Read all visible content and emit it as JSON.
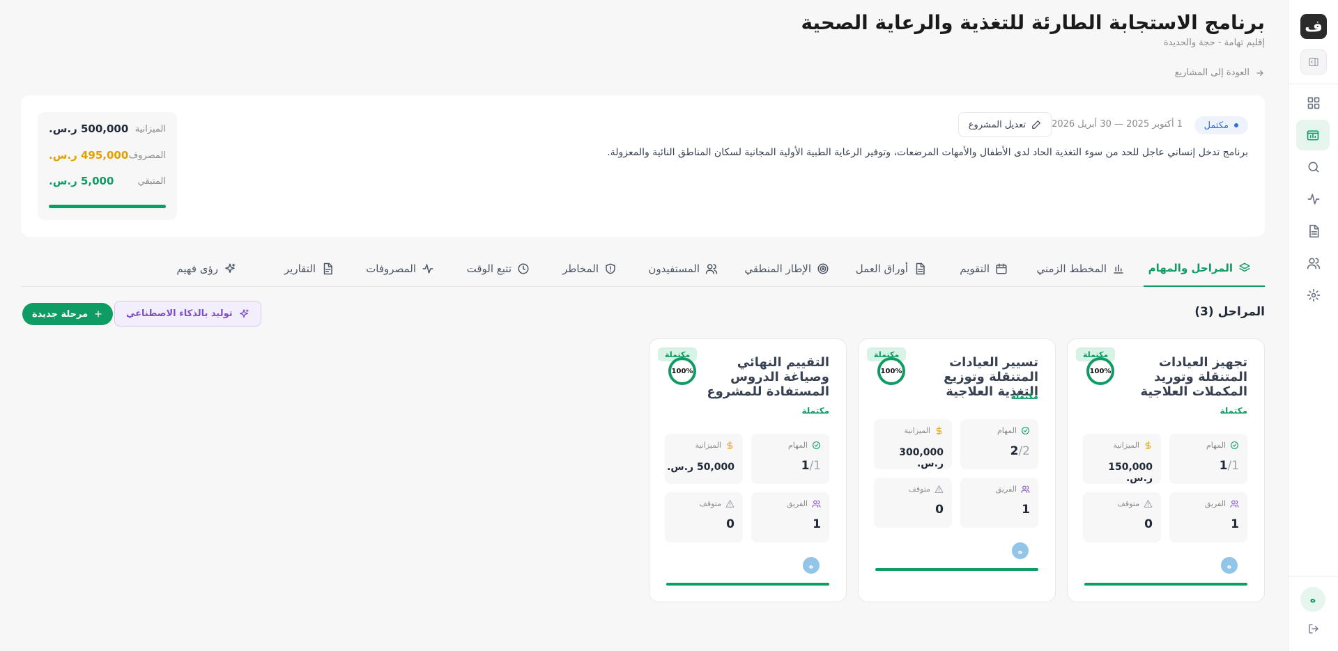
{
  "project": {
    "title": "برنامج الاستجابة الطارئة للتغذية والرعاية الصحية",
    "location": "إقليم تهامة - حجة والحديدة",
    "back_label": "العودة إلى المشاريع",
    "status": "مكتمل",
    "dates": "1 أكتوبر 2025 — 30 أبريل 2026",
    "edit_label": "تعديل المشروع",
    "description": "برنامج تدخل إنساني عاجل للحد من سوء التغذية الحاد لدى الأطفال والأمهات المرضعات، وتوفير الرعاية الطبية الأولية المجانية لسكان المناطق النائية والمعزولة.",
    "budget": {
      "budget_label": "الميزانية",
      "budget_value": "500,000 ر.س.",
      "spent_label": "المصروف",
      "spent_value": "495,000 ر.س.",
      "remaining_label": "المتبقي",
      "remaining_value": "5,000 ر.س.",
      "spent_fraction": 0.99
    }
  },
  "tabs": [
    {
      "label": "المراحل والمهام",
      "icon": "layers-icon",
      "active": true
    },
    {
      "label": "المخطط الزمني",
      "icon": "bar-chart-icon"
    },
    {
      "label": "التقويم",
      "icon": "calendar-icon"
    },
    {
      "label": "أوراق العمل",
      "icon": "file-icon"
    },
    {
      "label": "الإطار المنطقي",
      "icon": "target-icon"
    },
    {
      "label": "المستفيدون",
      "icon": "users-icon"
    },
    {
      "label": "المخاطر",
      "icon": "shield-icon"
    },
    {
      "label": "تتبع الوقت",
      "icon": "clock-icon"
    },
    {
      "label": "المصروفات",
      "icon": "activity-icon"
    },
    {
      "label": "التقارير",
      "icon": "report-icon"
    },
    {
      "label": "رؤى فهيم",
      "icon": "sparkles-icon"
    }
  ],
  "phases": {
    "heading": "المراحل (3)",
    "ai_label": "توليد بالذكاء الاصطناعي",
    "new_label": "مرحلة جديدة",
    "labels": {
      "tasks": "المهام",
      "budget": "الميزانية",
      "team": "الفريق",
      "stopped": "متوقف"
    },
    "items": [
      {
        "title": "تجهيز العيادات المتنقلة وتوريد المكملات العلاجية",
        "badge": "مكتملة",
        "percent": "100%",
        "progress": 1.0,
        "status": "مكتملة",
        "tasks_done": "1",
        "tasks_total": "/1",
        "budget": "150,000 ر.س.",
        "team": "1",
        "stopped": "0",
        "avatar": "ه"
      },
      {
        "title": "تسيير العيادات المتنقلة وتوزيع التغذية العلاجية",
        "badge": "مكتملة",
        "percent": "100%",
        "progress": 1.0,
        "status": "مكتملة",
        "tasks_done": "2",
        "tasks_total": "/2",
        "budget": "300,000 ر.س.",
        "team": "1",
        "stopped": "0",
        "avatar": "ه"
      },
      {
        "title": "التقييم النهائي وصياغة الدروس المستفادة للمشروع",
        "badge": "مكتملة",
        "percent": "100%",
        "progress": 1.0,
        "status": "مكتملة",
        "tasks_done": "1",
        "tasks_total": "/1",
        "budget": "50,000 ر.س.",
        "team": "1",
        "stopped": "0",
        "avatar": "ه"
      }
    ]
  },
  "rail": {
    "logo": "ف",
    "user_initial": "ه",
    "items": [
      "panel-toggle-icon",
      "dashboard-icon",
      "projects-icon",
      "search-icon",
      "activity-icon",
      "document-icon",
      "users-icon",
      "settings-icon",
      "logout-icon"
    ]
  },
  "colors": {
    "accent": "#0f9b64",
    "spent": "#e0a100",
    "remaining": "#0f9b64",
    "status_blue": "#2f6fd6",
    "ai_purple": "#7c4fc7"
  }
}
